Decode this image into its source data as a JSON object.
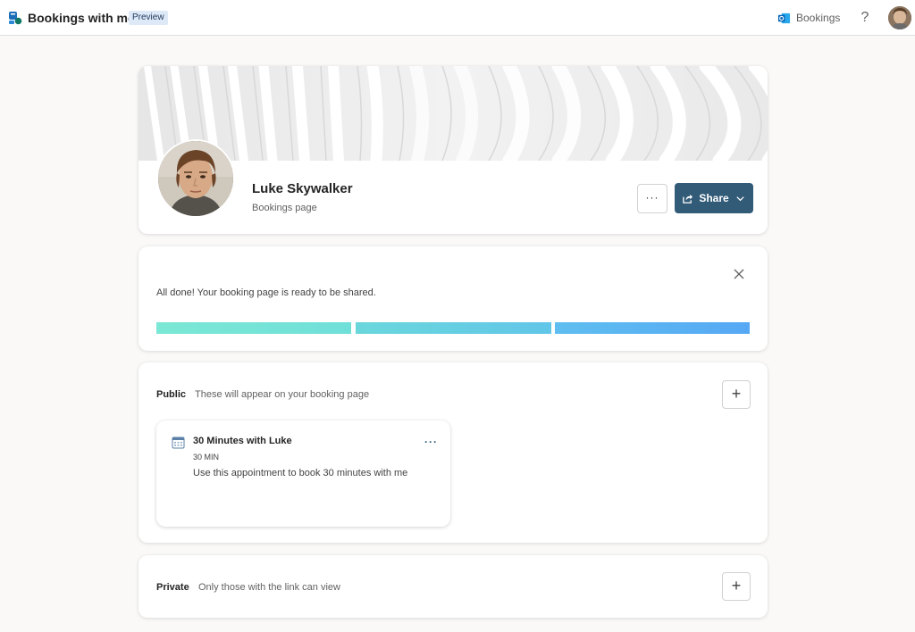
{
  "topbar": {
    "app_title": "Bookings with me",
    "badge": "Preview",
    "bookings_link": "Bookings",
    "help": "?"
  },
  "profile": {
    "name": "Luke Skywalker",
    "subtitle": "Bookings page",
    "more_label": "···",
    "share_label": "Share"
  },
  "done": {
    "message": "All done! Your booking page is ready to be shared.",
    "progress_segments_complete": 3,
    "progress_segments_total": 3
  },
  "public_section": {
    "title": "Public",
    "description": "These will appear on your booking page",
    "add_label": "+",
    "services": [
      {
        "title": "30 Minutes with Luke",
        "duration": "30 MIN",
        "description": "Use this appointment to book 30 minutes with me",
        "more_label": "···"
      }
    ]
  },
  "private_section": {
    "title": "Private",
    "description": "Only those with the link can view",
    "add_label": "+"
  },
  "colors": {
    "share_button": "#325b78",
    "badge_bg": "#dde9f6",
    "progress_start": "#7be8d5",
    "progress_end": "#56a8f4",
    "page_bg": "#faf9f8"
  },
  "icons": [
    "bookings-app-icon",
    "outlook-icon",
    "help-icon",
    "user-avatar",
    "share-icon",
    "chevron-down-icon",
    "close-icon",
    "calendar-icon",
    "add-icon",
    "more-icon"
  ]
}
